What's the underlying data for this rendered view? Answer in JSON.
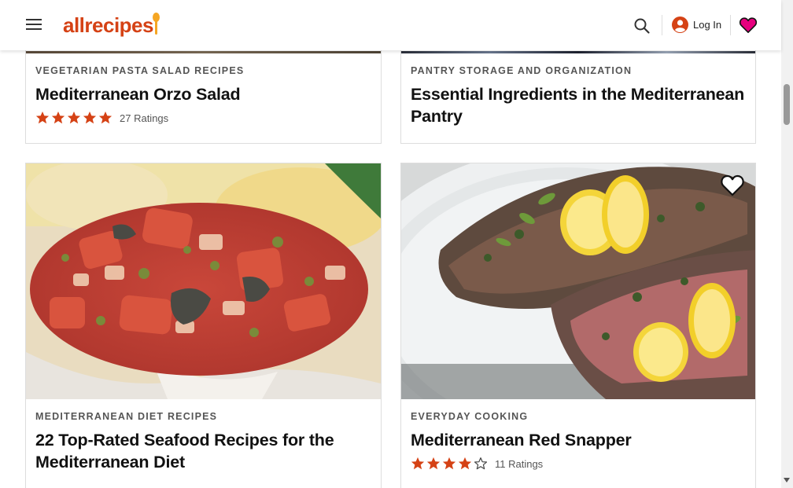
{
  "header": {
    "logo_text": "allrecipes",
    "login_label": "Log In",
    "icons": {
      "menu": "menu-icon",
      "search": "search-icon",
      "account": "account-icon",
      "favorites": "heart-icon"
    }
  },
  "colors": {
    "brand": "#d54215",
    "spoon": "#f5a623",
    "star": "#d54215",
    "favorites": "#e6007e"
  },
  "cards": [
    {
      "kicker": "VEGETARIAN PASTA SALAD RECIPES",
      "title": "Mediterranean Orzo Salad",
      "rating_stars": 5,
      "ratings_label": "27 Ratings"
    },
    {
      "kicker": "PANTRY STORAGE AND ORGANIZATION",
      "title": "Essential Ingredients in the Mediterranean Pantry"
    },
    {
      "kicker": "MEDITERRANEAN DIET RECIPES",
      "title": "22 Top-Rated Seafood Recipes for the Mediterranean Diet",
      "image": "tomato-caper-fish-photo"
    },
    {
      "kicker": "EVERYDAY COOKING",
      "title": "Mediterranean Red Snapper",
      "rating_stars": 4,
      "ratings_label": "11 Ratings",
      "image": "red-snapper-lemon-photo"
    }
  ]
}
